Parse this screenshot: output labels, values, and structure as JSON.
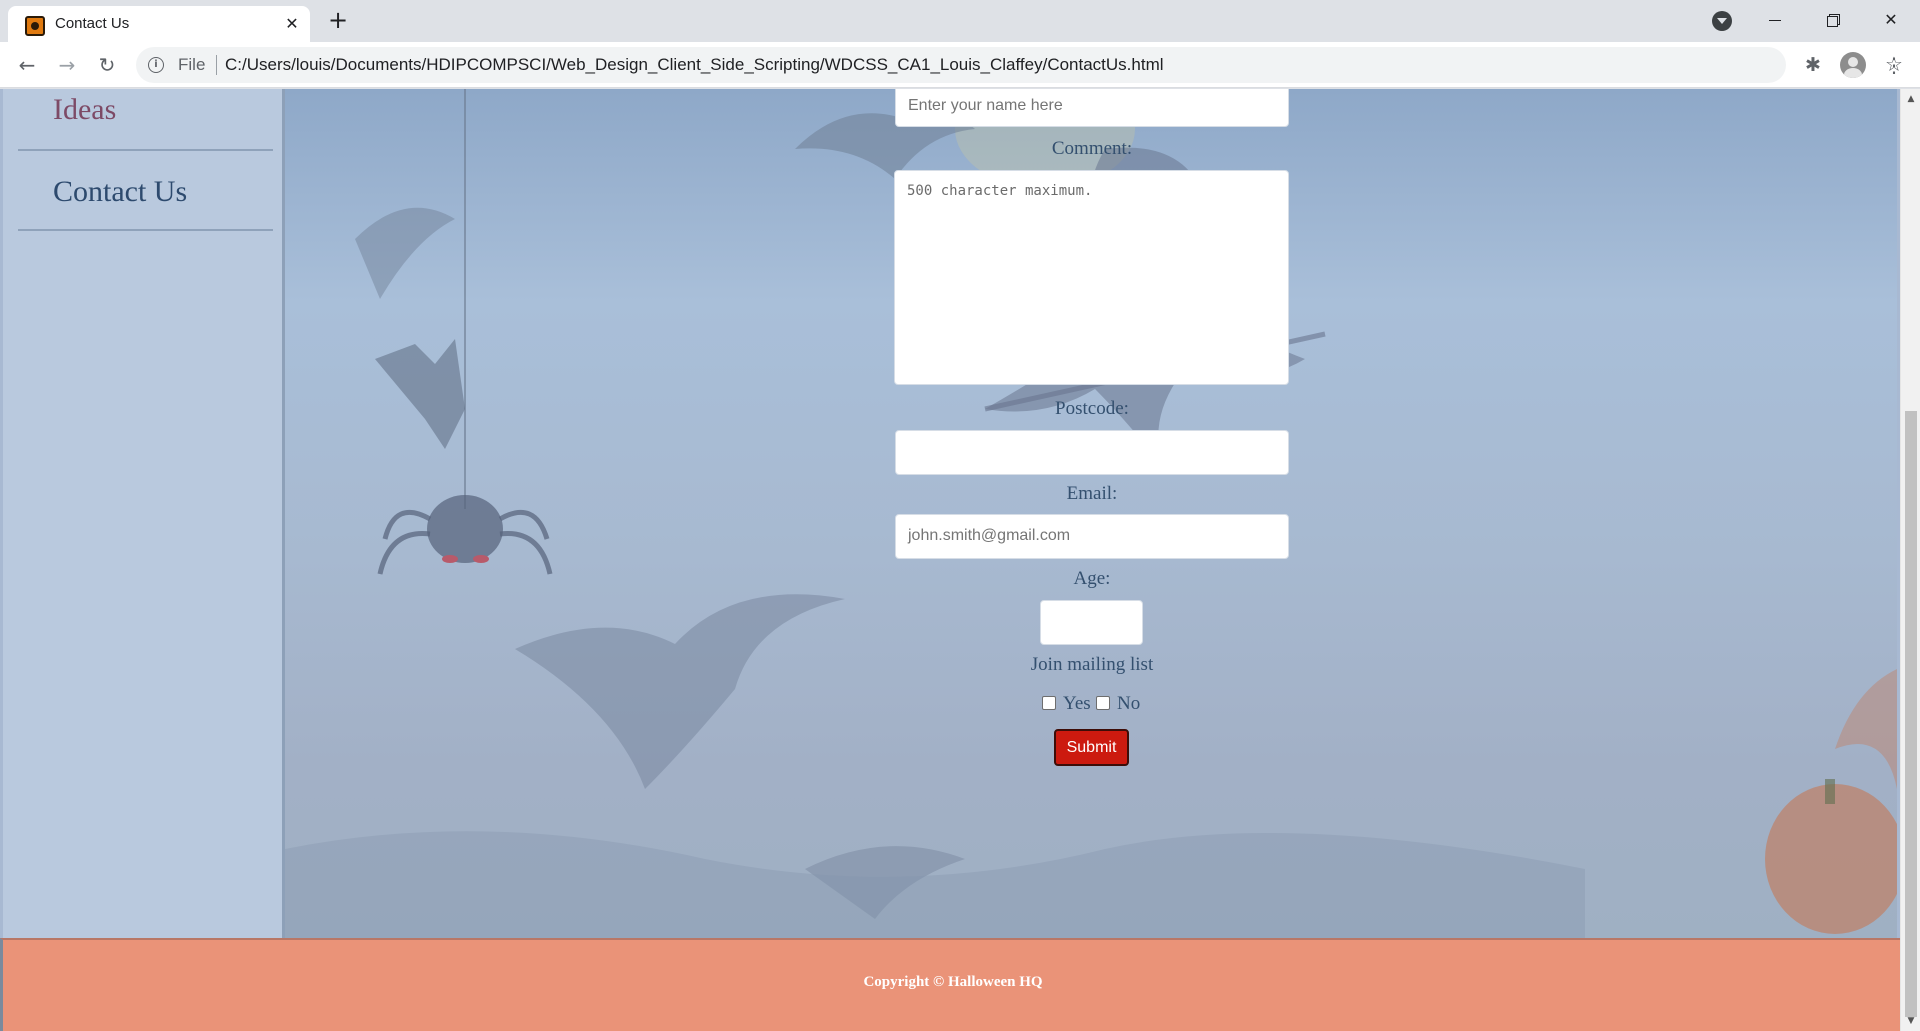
{
  "browser": {
    "tab_title": "Contact Us",
    "tab_close": "✕",
    "new_tab": "+",
    "back": "←",
    "forward": "→",
    "reload": "↻",
    "info": "i",
    "scheme": "File",
    "url": "C:/Users/louis/Documents/HDIPCOMPSCI/Web_Design_Client_Side_Scripting/WDCSS_CA1_Louis_Claffey/ContactUs.html",
    "star": "☆",
    "extensions": "✱",
    "menu": "⋮",
    "window_close": "✕"
  },
  "sidebar": {
    "items": [
      {
        "label": "Ideas",
        "color": "#7d4a66"
      },
      {
        "label": "Contact Us",
        "color": "#2d4a6e"
      }
    ]
  },
  "form": {
    "name_placeholder": "Enter your name here",
    "comment_label": "Comment:",
    "comment_placeholder": "500 character maximum.",
    "postcode_label": "Postcode:",
    "postcode_value": "",
    "email_label": "Email:",
    "email_placeholder": "john.smith@gmail.com",
    "age_label": "Age:",
    "age_value": "",
    "mailing_label": "Join mailing list",
    "yes_label": "Yes",
    "no_label": "No",
    "yes_checked": false,
    "no_checked": false,
    "submit_label": "Submit",
    "submit_color": "#cc1a0f"
  },
  "footer": {
    "copyright": "Copyright © Halloween HQ",
    "background": "#ea9378"
  },
  "scrollbar": {
    "up": "▲",
    "down": "▼"
  }
}
